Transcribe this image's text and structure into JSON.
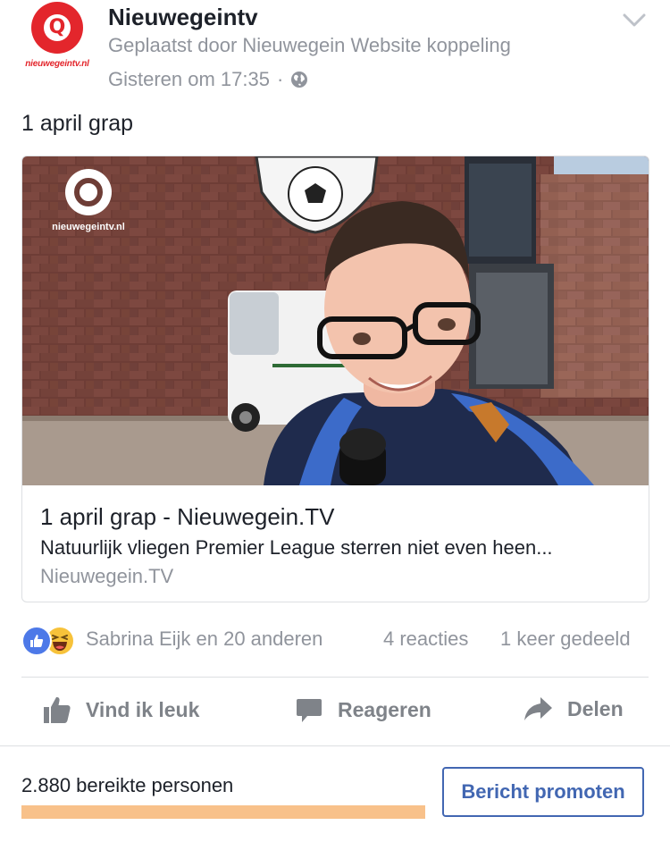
{
  "post": {
    "page_name": "Nieuwegeintv",
    "avatar_brand": "nieuwegeintv.nl",
    "posted_by": "Geplaatst door Nieuwegein Website koppeling",
    "timestamp": "Gisteren om 17:35",
    "separator": "·",
    "privacy_icon": "globe-icon",
    "menu_icon": "chevron-down-icon",
    "text": "1 april grap"
  },
  "link_card": {
    "watermark": "nieuwegeintv.nl",
    "title": "1 april grap - Nieuwegein.TV",
    "description": "Natuurlijk vliegen Premier League sterren niet even heen...",
    "domain": "Nieuwegein.TV"
  },
  "stats": {
    "reaction_icons": [
      "like-icon",
      "haha-icon"
    ],
    "names": "Sabrina Eijk en 20 anderen",
    "reactions": "4 reacties",
    "shares": "1 keer gedeeld"
  },
  "actions": {
    "like": "Vind ik leuk",
    "comment": "Reageren",
    "share": "Delen"
  },
  "footer": {
    "reach": "2.880 bereikte personen",
    "reach_progress": 1.0,
    "promote": "Bericht promoten"
  },
  "colors": {
    "brand_red": "#e3262c",
    "accent_blue": "#4267b2",
    "reach_bar": "#f8c18a",
    "muted_text": "#90949c"
  }
}
